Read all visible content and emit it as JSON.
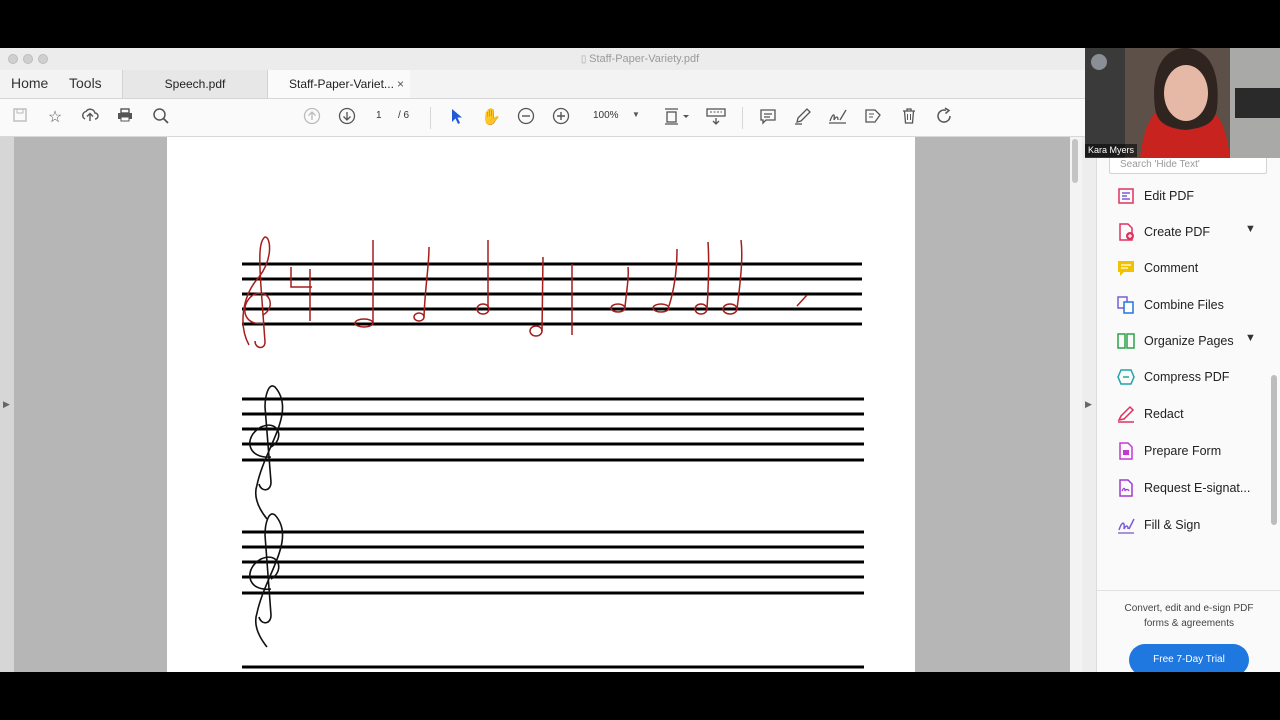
{
  "window": {
    "title": "Staff-Paper-Variety.pdf"
  },
  "nav": {
    "home": "Home",
    "tools": "Tools"
  },
  "tabs": [
    {
      "label": "Speech.pdf"
    },
    {
      "label": "Staff-Paper-Variet...",
      "close": "×"
    }
  ],
  "toolbar": {
    "page_current": "1",
    "page_total": "/ 6",
    "zoom": "100%",
    "icons": [
      "save-icon",
      "star-icon",
      "upload-icon",
      "print-icon",
      "zoom-search-icon",
      "prev-page-icon",
      "next-page-icon",
      "select-cursor-icon",
      "hand-icon",
      "zoom-out-icon",
      "zoom-in-icon",
      "page-fit-icon",
      "scroll-mode-icon",
      "comment-icon",
      "highlight-pen-icon",
      "sign-icon",
      "stamp-icon",
      "delete-icon",
      "rotate-icon"
    ]
  },
  "right_panel": {
    "search_placeholder": "Search 'Hide Text'",
    "tools": [
      {
        "label": "Edit PDF",
        "color": "#e0325f"
      },
      {
        "label": "Create PDF",
        "color": "#e0325f",
        "expandable": true
      },
      {
        "label": "Comment",
        "color": "#f2c200"
      },
      {
        "label": "Combine Files",
        "color": "#7b5cd6"
      },
      {
        "label": "Organize Pages",
        "color": "#2aa34a",
        "expandable": true
      },
      {
        "label": "Compress PDF",
        "color": "#1fa4a8"
      },
      {
        "label": "Redact",
        "color": "#e0325f"
      },
      {
        "label": "Prepare Form",
        "color": "#c33ad0"
      },
      {
        "label": "Request E-signat...",
        "color": "#a23ad0"
      },
      {
        "label": "Fill & Sign",
        "color": "#7b5cd6"
      }
    ],
    "promo_text": "Convert, edit and e-sign PDF forms & agreements",
    "trial_button": "Free 7-Day Trial"
  },
  "webcam": {
    "name": "Kara Myers"
  },
  "colors": {
    "ink": "#a51d1d",
    "accent": "#1f77e0"
  }
}
